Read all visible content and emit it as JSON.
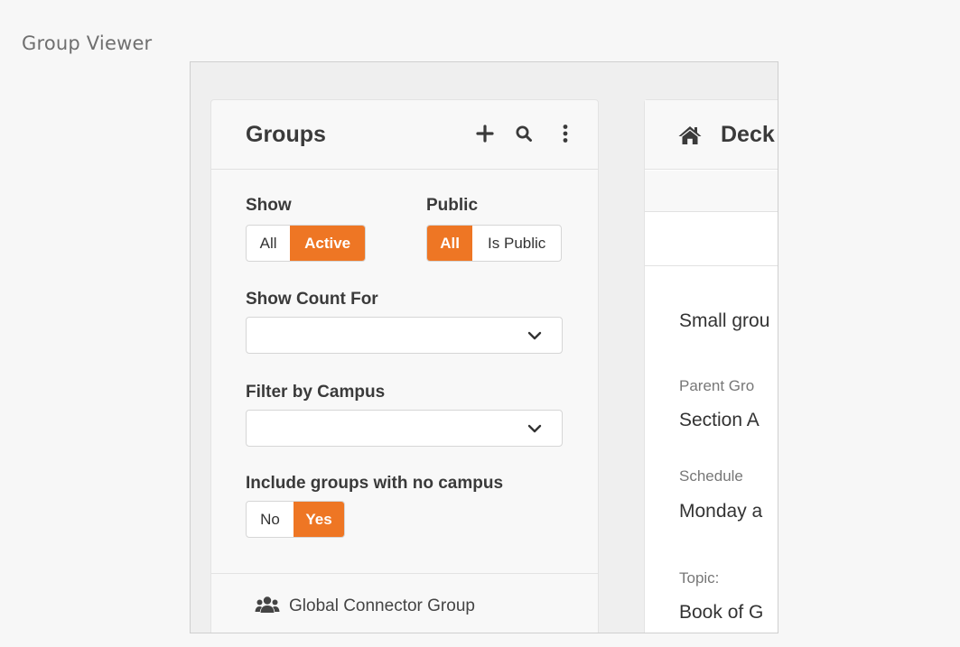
{
  "page": {
    "caption": "Group Viewer"
  },
  "groups_panel": {
    "title": "Groups",
    "header_icons": [
      "plus-icon",
      "search-icon",
      "kebab-menu-icon"
    ],
    "show": {
      "label": "Show",
      "options": [
        "All",
        "Active"
      ],
      "selected": "Active"
    },
    "public": {
      "label": "Public",
      "options": [
        "All",
        "Is Public"
      ],
      "selected": "All"
    },
    "show_count_for": {
      "label": "Show Count For",
      "value": ""
    },
    "filter_by_campus": {
      "label": "Filter by Campus",
      "value": ""
    },
    "include_no_campus": {
      "label": "Include groups with no campus",
      "options": [
        "No",
        "Yes"
      ],
      "selected": "Yes"
    },
    "tree": [
      {
        "label": "Global Connector Group",
        "icon": "users-icon"
      }
    ]
  },
  "detail_panel": {
    "title": "Deck",
    "title_icon": "home-icon",
    "description": "Small grou",
    "fields": [
      {
        "label": "Parent Gro",
        "value": "Section A"
      },
      {
        "label": "Schedule",
        "value": "Monday a"
      },
      {
        "label": "Topic:",
        "value": "Book of G"
      }
    ]
  },
  "colors": {
    "accent": "#ee7624",
    "panel_bg": "#f8f8f8",
    "page_bg": "#f7f7f7"
  }
}
